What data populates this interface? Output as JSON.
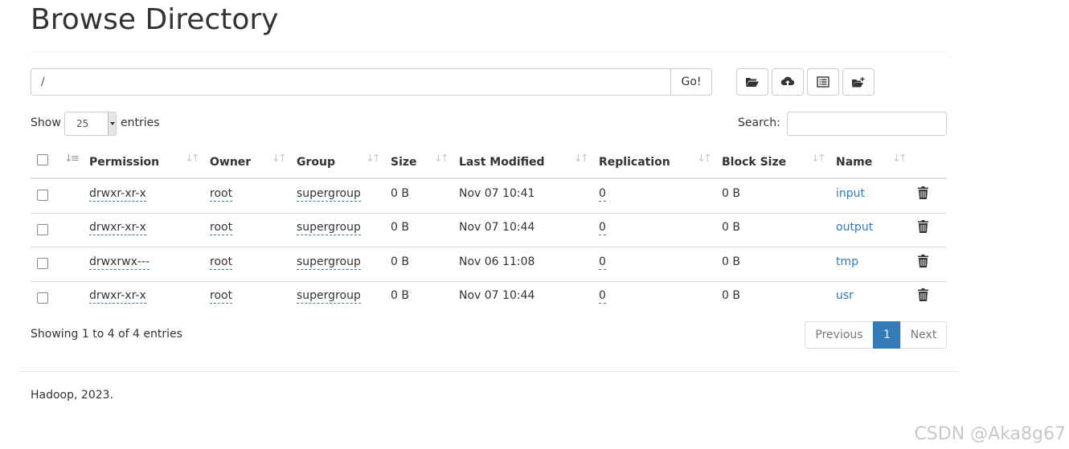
{
  "title": "Browse Directory",
  "path": {
    "value": "/",
    "go_label": "Go!"
  },
  "toolbar": {
    "buttons": [
      "folder-open-icon",
      "cloud-upload-icon",
      "list-alt-icon",
      "folder-new-icon"
    ]
  },
  "length": {
    "show_label": "Show",
    "selected": "25",
    "entries_label": "entries"
  },
  "search": {
    "label": "Search:",
    "value": ""
  },
  "table": {
    "columns": [
      "Permission",
      "Owner",
      "Group",
      "Size",
      "Last Modified",
      "Replication",
      "Block Size",
      "Name"
    ],
    "rows": [
      {
        "permission": "drwxr-xr-x",
        "owner": "root",
        "group": "supergroup",
        "size": "0 B",
        "modified": "Nov 07 10:41",
        "replication": "0",
        "block_size": "0 B",
        "name": "input"
      },
      {
        "permission": "drwxr-xr-x",
        "owner": "root",
        "group": "supergroup",
        "size": "0 B",
        "modified": "Nov 07 10:44",
        "replication": "0",
        "block_size": "0 B",
        "name": "output"
      },
      {
        "permission": "drwxrwx---",
        "owner": "root",
        "group": "supergroup",
        "size": "0 B",
        "modified": "Nov 06 11:08",
        "replication": "0",
        "block_size": "0 B",
        "name": "tmp"
      },
      {
        "permission": "drwxr-xr-x",
        "owner": "root",
        "group": "supergroup",
        "size": "0 B",
        "modified": "Nov 07 10:44",
        "replication": "0",
        "block_size": "0 B",
        "name": "usr"
      }
    ]
  },
  "info": "Showing 1 to 4 of 4 entries",
  "pagination": {
    "previous": "Previous",
    "current": "1",
    "next": "Next"
  },
  "footer": "Hadoop, 2023.",
  "watermark": "CSDN @Aka8g67",
  "colors": {
    "link": "#337ab7",
    "active_page": "#337ab7"
  }
}
